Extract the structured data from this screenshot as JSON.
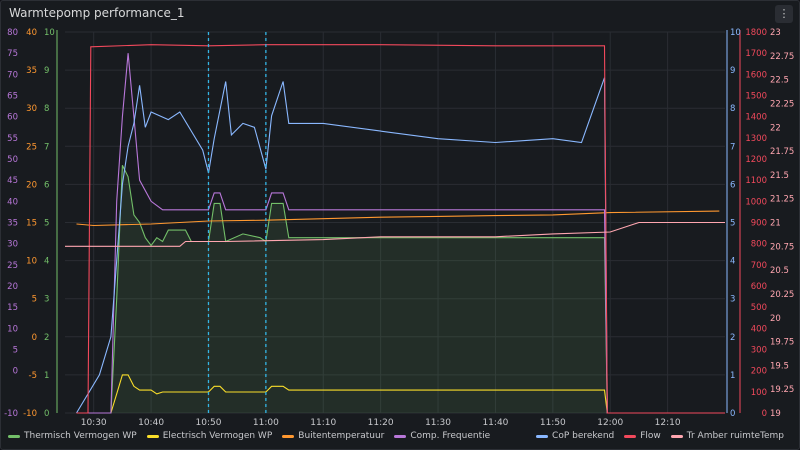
{
  "panel": {
    "title": "Warmtepomp performance_1",
    "menu_icon": "vertical-ellipsis-icon"
  },
  "legend": {
    "left": [
      {
        "label": "Thermisch Vermogen WP",
        "color": "#73bf69"
      },
      {
        "label": "Electrisch Vermogen WP",
        "color": "#fade2a"
      },
      {
        "label": "Buitentemperatuur",
        "color": "#ff9830"
      },
      {
        "label": "Comp. Frequentie",
        "color": "#b877d9"
      }
    ],
    "right": [
      {
        "label": "CoP berekend",
        "color": "#8ab8ff"
      },
      {
        "label": "Flow",
        "color": "#f2495c"
      },
      {
        "label": "Tr Amber ruimteTemp",
        "color": "#ffa6b0"
      }
    ]
  },
  "chart_data": {
    "type": "line",
    "x_ticks": [
      "10:30",
      "10:40",
      "10:50",
      "11:00",
      "11:10",
      "11:20",
      "11:30",
      "11:40",
      "11:50",
      "12:00",
      "12:10"
    ],
    "annotation_times": [
      "10:50",
      "11:00"
    ],
    "axes": {
      "comp_frequentie": {
        "ticks": [
          "-10",
          "0",
          "5",
          "10",
          "15",
          "20",
          "25",
          "30",
          "35",
          "40",
          "45",
          "50",
          "55",
          "60",
          "65",
          "70",
          "75",
          "80"
        ]
      },
      "buitentemperatuur": {
        "ticks": [
          "-10",
          "-5",
          "0",
          "5",
          "10",
          "15",
          "20",
          "25",
          "30",
          "35",
          "40"
        ]
      },
      "vermogen": {
        "ticks": [
          "0",
          "1",
          "2",
          "3",
          "4",
          "5",
          "6",
          "7",
          "8",
          "9",
          "10"
        ]
      },
      "cop": {
        "ticks": [
          "0",
          "1",
          "2",
          "3",
          "4",
          "5",
          "6",
          "7",
          "8",
          "9",
          "10"
        ]
      },
      "flow": {
        "ticks": [
          "0",
          "100",
          "200",
          "300",
          "400",
          "500",
          "600",
          "700",
          "800",
          "900",
          "1000",
          "1100",
          "1200",
          "1300",
          "1400",
          "1500",
          "1600",
          "1700",
          "1800"
        ]
      },
      "ruimtetemp": {
        "ticks": [
          "19",
          "19.25",
          "19.5",
          "19.75",
          "20",
          "20.25",
          "20.5",
          "20.75",
          "21",
          "21.25",
          "21.5",
          "21.75",
          "22",
          "22.25",
          "22.5",
          "22.75",
          "23"
        ]
      }
    },
    "series": [
      {
        "name": "Thermisch Vermogen WP",
        "axis": "vermogen",
        "color": "#73bf69",
        "points": [
          [
            "10:27",
            0
          ],
          [
            "10:33",
            0
          ],
          [
            "10:34",
            3
          ],
          [
            "10:35",
            6.5
          ],
          [
            "10:36",
            6.2
          ],
          [
            "10:37",
            5.2
          ],
          [
            "10:38",
            5.0
          ],
          [
            "10:39",
            4.6
          ],
          [
            "10:40",
            4.4
          ],
          [
            "10:41",
            4.6
          ],
          [
            "10:42",
            4.5
          ],
          [
            "10:43",
            4.8
          ],
          [
            "10:46",
            4.8
          ],
          [
            "10:47",
            4.5
          ],
          [
            "10:50",
            4.5
          ],
          [
            "10:51",
            5.5
          ],
          [
            "10:52",
            5.5
          ],
          [
            "10:53",
            4.5
          ],
          [
            "10:56",
            4.7
          ],
          [
            "10:59",
            4.6
          ],
          [
            "11:00",
            4.5
          ],
          [
            "11:01",
            5.5
          ],
          [
            "11:03",
            5.5
          ],
          [
            "11:04",
            4.6
          ],
          [
            "11:30",
            4.6
          ],
          [
            "11:50",
            4.6
          ],
          [
            "11:59",
            4.6
          ],
          [
            "11:59.5",
            0
          ],
          [
            "12:20",
            0
          ]
        ]
      },
      {
        "name": "Electrisch Vermogen WP",
        "axis": "vermogen",
        "color": "#fade2a",
        "points": [
          [
            "10:27",
            0
          ],
          [
            "10:33",
            0
          ],
          [
            "10:34",
            0.5
          ],
          [
            "10:35",
            1.0
          ],
          [
            "10:36",
            1.0
          ],
          [
            "10:37",
            0.7
          ],
          [
            "10:38",
            0.6
          ],
          [
            "10:39",
            0.6
          ],
          [
            "10:40",
            0.6
          ],
          [
            "10:41",
            0.5
          ],
          [
            "10:42",
            0.55
          ],
          [
            "10:50",
            0.55
          ],
          [
            "10:51",
            0.7
          ],
          [
            "10:52",
            0.7
          ],
          [
            "10:53",
            0.55
          ],
          [
            "11:00",
            0.55
          ],
          [
            "11:01",
            0.7
          ],
          [
            "11:03",
            0.7
          ],
          [
            "11:04",
            0.6
          ],
          [
            "11:30",
            0.6
          ],
          [
            "11:59",
            0.6
          ],
          [
            "11:59.5",
            0
          ],
          [
            "12:20",
            0
          ]
        ]
      },
      {
        "name": "Buitentemperatuur",
        "axis": "buitentemperatuur",
        "color": "#ff9830",
        "points": [
          [
            "10:27",
            14.8
          ],
          [
            "10:30",
            14.6
          ],
          [
            "10:40",
            14.8
          ],
          [
            "10:50",
            15.2
          ],
          [
            "11:00",
            15.3
          ],
          [
            "11:10",
            15.5
          ],
          [
            "11:20",
            15.7
          ],
          [
            "11:30",
            15.8
          ],
          [
            "11:40",
            15.9
          ],
          [
            "11:50",
            16.0
          ],
          [
            "12:00",
            16.3
          ],
          [
            "12:19",
            16.5
          ]
        ]
      },
      {
        "name": "Comp. Frequentie",
        "axis": "comp_frequentie",
        "color": "#b877d9",
        "points": [
          [
            "10:27",
            -10
          ],
          [
            "10:33",
            -10
          ],
          [
            "10:34",
            40
          ],
          [
            "10:35",
            60
          ],
          [
            "10:36",
            75
          ],
          [
            "10:37",
            60
          ],
          [
            "10:38",
            45
          ],
          [
            "10:40",
            40
          ],
          [
            "10:42",
            38
          ],
          [
            "10:50",
            38
          ],
          [
            "10:51",
            42
          ],
          [
            "10:52",
            42
          ],
          [
            "10:53",
            38
          ],
          [
            "11:00",
            38
          ],
          [
            "11:01",
            42
          ],
          [
            "11:03",
            42
          ],
          [
            "11:04",
            38
          ],
          [
            "11:59",
            38
          ],
          [
            "11:59.5",
            -10
          ],
          [
            "12:20",
            -10
          ]
        ]
      },
      {
        "name": "CoP berekend",
        "axis": "cop",
        "color": "#8ab8ff",
        "points": [
          [
            "10:27",
            0
          ],
          [
            "10:31",
            1
          ],
          [
            "10:33",
            2
          ],
          [
            "10:34",
            4
          ],
          [
            "10:35",
            6
          ],
          [
            "10:36",
            7
          ],
          [
            "10:37",
            7.6
          ],
          [
            "10:38",
            8.6
          ],
          [
            "10:39",
            7.5
          ],
          [
            "10:40",
            7.9
          ],
          [
            "10:43",
            7.7
          ],
          [
            "10:45",
            7.9
          ],
          [
            "10:47",
            7.4
          ],
          [
            "10:49",
            6.9
          ],
          [
            "10:50",
            6.3
          ],
          [
            "10:51",
            7.2
          ],
          [
            "10:53",
            8.7
          ],
          [
            "10:54",
            7.3
          ],
          [
            "10:56",
            7.6
          ],
          [
            "10:58",
            7.5
          ],
          [
            "11:00",
            6.4
          ],
          [
            "11:01",
            7.8
          ],
          [
            "11:03",
            8.7
          ],
          [
            "11:04",
            7.6
          ],
          [
            "11:10",
            7.6
          ],
          [
            "11:20",
            7.4
          ],
          [
            "11:30",
            7.2
          ],
          [
            "11:40",
            7.1
          ],
          [
            "11:50",
            7.2
          ],
          [
            "11:55",
            7.1
          ],
          [
            "11:59",
            8.8
          ],
          [
            "11:59.5",
            0
          ],
          [
            "12:20",
            0
          ]
        ]
      },
      {
        "name": "Flow",
        "axis": "flow",
        "color": "#f2495c",
        "points": [
          [
            "10:27",
            0
          ],
          [
            "10:29",
            0
          ],
          [
            "10:29.5",
            1730
          ],
          [
            "10:40",
            1740
          ],
          [
            "10:50",
            1735
          ],
          [
            "11:00",
            1740
          ],
          [
            "11:20",
            1740
          ],
          [
            "11:40",
            1735
          ],
          [
            "11:59",
            1735
          ],
          [
            "11:59.5",
            0
          ],
          [
            "12:20",
            0
          ]
        ]
      },
      {
        "name": "Tr Amber ruimteTemp",
        "axis": "ruimtetemp",
        "color": "#ffa6b0",
        "points": [
          [
            "10:25",
            20.75
          ],
          [
            "10:45",
            20.75
          ],
          [
            "10:46",
            20.8
          ],
          [
            "10:53",
            20.8
          ],
          [
            "11:10",
            20.82
          ],
          [
            "11:20",
            20.85
          ],
          [
            "11:40",
            20.85
          ],
          [
            "11:50",
            20.88
          ],
          [
            "12:00",
            20.9
          ],
          [
            "12:05",
            21.0
          ],
          [
            "12:20",
            21.0
          ]
        ]
      }
    ]
  }
}
